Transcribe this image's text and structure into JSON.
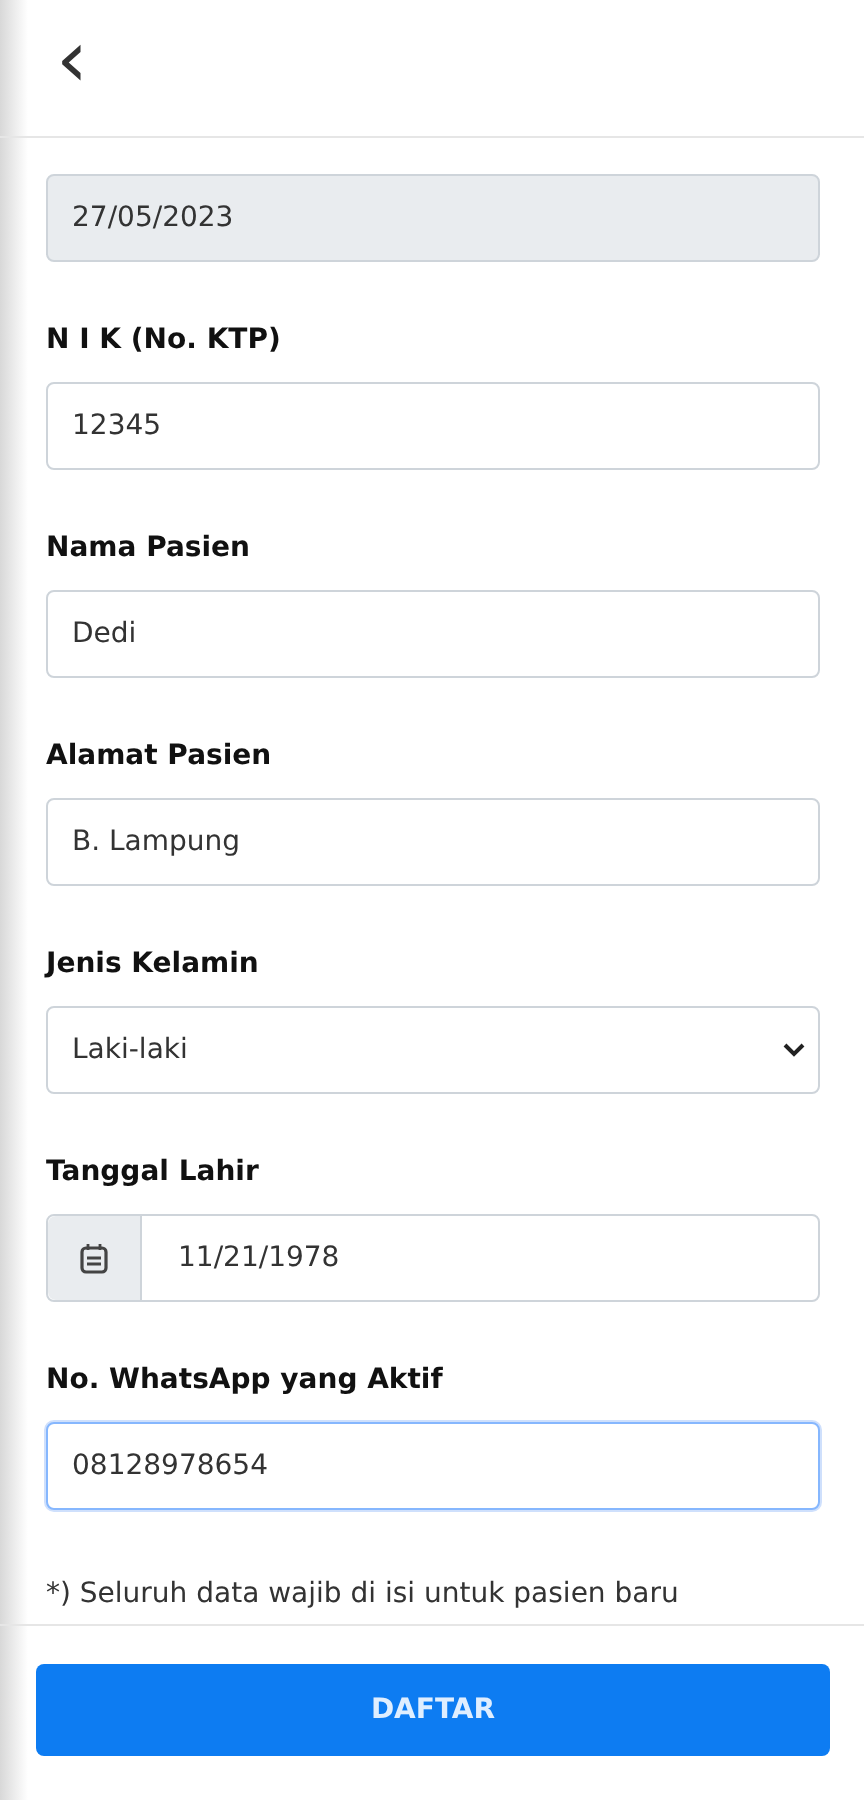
{
  "header": {
    "back": "‹"
  },
  "fields": [
    {
      "kind": "text",
      "value": "27/05/2023",
      "disabled": true,
      "focused": false
    },
    {
      "kind": "text",
      "label": "N I K (No. KTP)",
      "value": "12345",
      "disabled": false,
      "focused": false
    },
    {
      "kind": "text",
      "label": "Nama Pasien",
      "value": "Dedi",
      "disabled": false,
      "focused": false
    },
    {
      "kind": "text",
      "label": "Alamat Pasien",
      "value": "B. Lampung",
      "disabled": false,
      "focused": false
    },
    {
      "kind": "select",
      "label": "Jenis Kelamin",
      "value": "Laki-laki",
      "disabled": false,
      "focused": false
    },
    {
      "kind": "date",
      "label": "Tanggal Lahir",
      "value": "11/21/1978",
      "disabled": false,
      "focused": false
    },
    {
      "kind": "text",
      "label": "No. WhatsApp yang Aktif",
      "value": "08128978654",
      "disabled": false,
      "focused": true
    }
  ],
  "note": "*) Seluruh data wajib di isi untuk pasien baru",
  "submit": "DAFTAR"
}
